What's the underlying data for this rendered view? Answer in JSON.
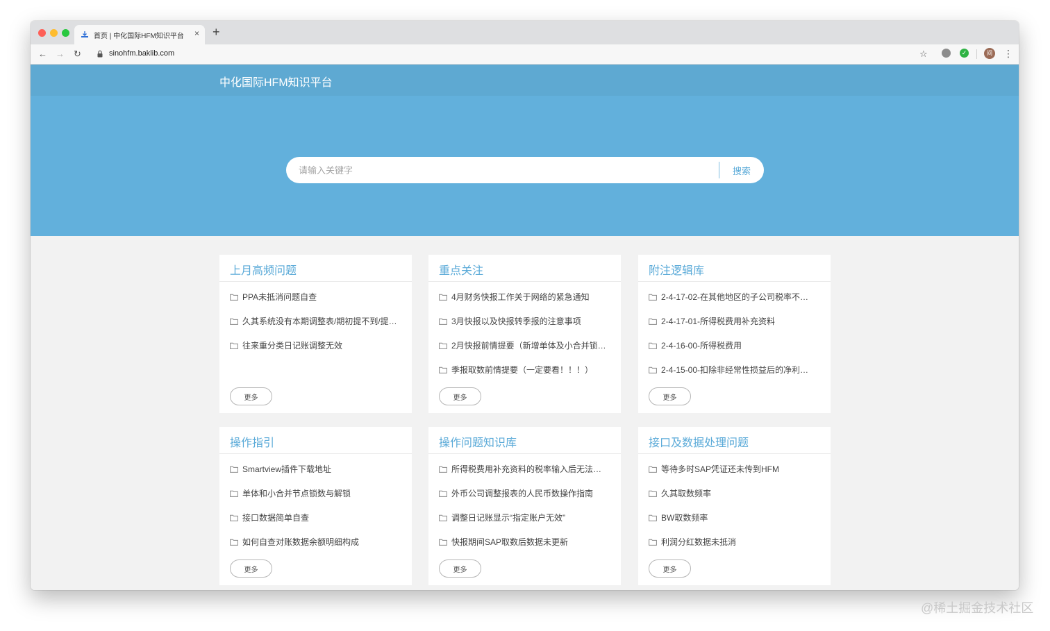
{
  "browser": {
    "tab_title": "首页 | 中化国际HFM知识平台",
    "url": "sinohfm.baklib.com",
    "new_tab_symbol": "+",
    "close_symbol": "×",
    "avatar_initial": "间"
  },
  "site": {
    "logo_text": "中化国际HFM知识平台"
  },
  "search": {
    "placeholder": "请输入关键字",
    "button_label": "搜索"
  },
  "cards": [
    {
      "title": "上月高频问题",
      "items": [
        "PPA未抵消问题自查",
        "久其系统没有本期调整表/期初提不到/提…",
        "往来重分类日记账调整无效"
      ],
      "more_label": "更多"
    },
    {
      "title": "重点关注",
      "items": [
        "4月财务快报工作关于网络的紧急通知",
        "3月快报以及快报转季报的注意事项",
        "2月快报前情提要（新增单体及小合并锁…",
        "季报取数前情提要（一定要看！！！）"
      ],
      "more_label": "更多"
    },
    {
      "title": "附注逻辑库",
      "items": [
        "2-4-17-02-在其他地区的子公司税率不…",
        "2-4-17-01-所得税费用补充资料",
        "2-4-16-00-所得税费用",
        "2-4-15-00-扣除非经常性损益后的净利…"
      ],
      "more_label": "更多"
    },
    {
      "title": "操作指引",
      "items": [
        "Smartview插件下载地址",
        "单体和小合并节点锁数与解锁",
        "接口数据简单自查",
        "如何自查对账数据余额明细构成"
      ],
      "more_label": "更多"
    },
    {
      "title": "操作问题知识库",
      "items": [
        "所得税费用补充资料的税率输入后无法…",
        "外币公司调整报表的人民币数操作指南",
        "调整日记账显示“指定账户无效”",
        "快报期间SAP取数后数据未更新"
      ],
      "more_label": "更多"
    },
    {
      "title": "接口及数据处理问题",
      "items": [
        "等待多时SAP凭证还未传到HFM",
        "久其取数频率",
        "BW取数频率",
        "利润分红数据未抵消"
      ],
      "more_label": "更多"
    }
  ],
  "watermark": "@稀土掘金技术社区",
  "colors": {
    "header_bg": "#5ea9d2",
    "hero_bg": "#62b0dc",
    "accent": "#5aaad8",
    "page_bg": "#f2f2f2"
  },
  "icons": {
    "folder": "folder-icon",
    "back": "arrow-left-icon",
    "forward": "arrow-right-icon",
    "reload": "reload-icon",
    "lock": "lock-icon",
    "star": "star-icon",
    "menu": "kebab-menu-icon"
  }
}
